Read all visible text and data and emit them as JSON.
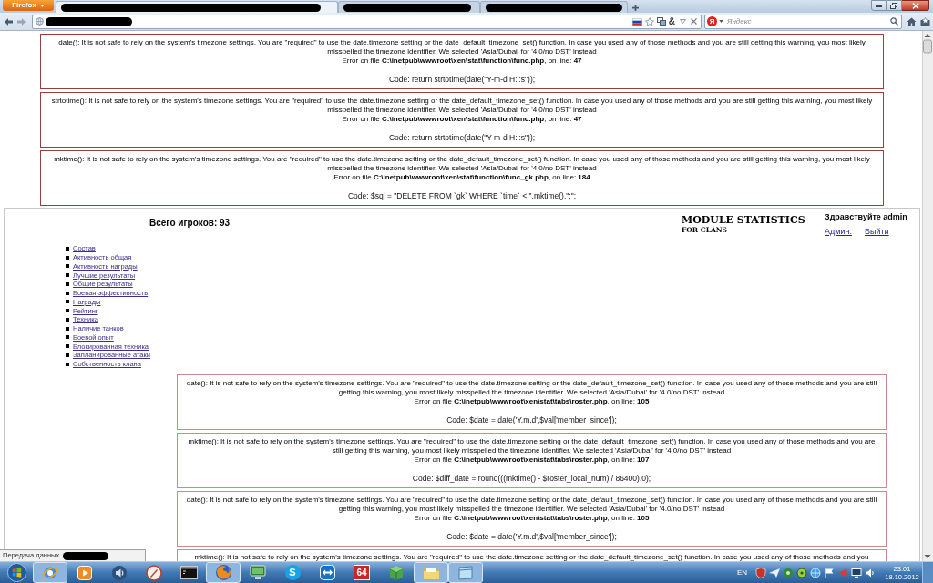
{
  "browser": {
    "menu_button": "Firefox",
    "tabs": [
      {
        "selected": true
      },
      {
        "selected": false
      },
      {
        "selected": false
      }
    ],
    "address_bar": {
      "addon_glyph": "&"
    },
    "search": {
      "engine_logo": "Я",
      "placeholder": "Яндекс"
    },
    "status_popup": "Передача данных"
  },
  "warnings_top": [
    {
      "message": "date(): It is not safe to rely on the system's timezone settings. You are \"required\" to use the date.timezone setting or the date_default_timezone_set() function. In case you used any of those methods and you are still getting this warning, you most likely misspelled the timezone identifier. We selected 'Asia/Dubai' for '4.0/no DST' instead",
      "location": "Error on file **C:\\inetpub\\wwwroot\\xen\\stat\\function\\func.php**, on line: **47**",
      "code": "Code: return strtotime(date(\"Y-m-d H:i:s\"));"
    },
    {
      "message": "strtotime(): It is not safe to rely on the system's timezone settings. You are \"required\" to use the date.timezone setting or the date_default_timezone_set() function. In case you used any of those methods and you are still getting this warning, you most likely misspelled the timezone identifier. We selected 'Asia/Dubai' for '4.0/no DST' instead",
      "location": "Error on file **C:\\inetpub\\wwwroot\\xen\\stat\\function\\func.php**, on line: **47**",
      "code": "Code: return strtotime(date(\"Y-m-d H:i:s\"));"
    },
    {
      "message": "mktime(): It is not safe to rely on the system's timezone settings. You are \"required\" to use the date.timezone setting or the date_default_timezone_set() function. In case you used any of those methods and you are still getting this warning, you most likely misspelled the timezone identifier. We selected 'Asia/Dubai' for '4.0/no DST' instead",
      "location": "Error on file **C:\\inetpub\\wwwroot\\xen\\stat\\function\\func_gk.php**, on line: **184**",
      "code": "Code: $sql = \"DELETE FROM `gk` WHERE `time` < \".mktime().\";\";"
    }
  ],
  "page": {
    "player_count": "Всего игроков: 93",
    "logo": {
      "title": "MODULE STATISTICS",
      "subtitle": "FOR CLANS"
    },
    "greeting": "Здравствуйте admin",
    "user_links": [
      "Админ.",
      "Выйти"
    ],
    "menu": [
      "Состав",
      "Активность общая",
      "Активность награды",
      "Лучшие результаты",
      "Общие результаты",
      "Боевая эффективность",
      "Награды",
      "Рейтинг",
      "Техника",
      "Наличие танков",
      "Боевой опыт",
      "Блокированная техника",
      "Запланированные атаки",
      "Собственность клана"
    ]
  },
  "warnings_bottom": [
    {
      "message": "date(): It is not safe to rely on the system's timezone settings. You are \"required\" to use the date.timezone setting or the date_default_timezone_set() function. In case you used any of those methods and you are still getting this warning, you most likely misspelled the timezone identifier. We selected 'Asia/Dubai' for '4.0/no DST' instead",
      "location": "Error on file **C:\\inetpub\\wwwroot\\xen\\stat\\tabs\\roster.php**, on line: **105**",
      "code": "Code: $date = date('Y.m.d',$val['member_since']);"
    },
    {
      "message": "mktime(): It is not safe to rely on the system's timezone settings. You are \"required\" to use the date.timezone setting or the date_default_timezone_set() function. In case you used any of those methods and you are still getting this warning, you most likely misspelled the timezone identifier. We selected 'Asia/Dubai' for '4.0/no DST' instead",
      "location": "Error on file **C:\\inetpub\\wwwroot\\xen\\stat\\tabs\\roster.php**, on line: **107**",
      "code": "Code: $diff_date = round(((mktime() - $roster_local_num) / 86400),0);"
    },
    {
      "message": "date(): It is not safe to rely on the system's timezone settings. You are \"required\" to use the date.timezone setting or the date_default_timezone_set() function. In case you used any of those methods and you are still getting this warning, you most likely misspelled the timezone identifier. We selected 'Asia/Dubai' for '4.0/no DST' instead",
      "location": "Error on file **C:\\inetpub\\wwwroot\\xen\\stat\\tabs\\roster.php**, on line: **105**",
      "code": "Code: $date = date('Y.m.d',$val['member_since']);"
    },
    {
      "message": "mktime(): It is not safe to rely on the system's timezone settings. You are \"required\" to use the date.timezone setting or the date_default_timezone_set() function. In case you used any of those methods and you"
    }
  ],
  "taskbar": {
    "apps": [
      {
        "kind": "globe-ring",
        "running": true
      },
      {
        "kind": "play-tile",
        "running": false
      },
      {
        "kind": "speaker-disc",
        "running": false
      },
      {
        "kind": "slashed-ring",
        "running": false
      },
      {
        "kind": "terminal",
        "running": false
      },
      {
        "kind": "swirl-globe",
        "running": true
      },
      {
        "kind": "monitor",
        "running": false
      },
      {
        "kind": "letter-disc",
        "label": "S",
        "running": false
      },
      {
        "kind": "arrow-tile",
        "running": false
      },
      {
        "kind": "number-tile",
        "label": "64",
        "running": false
      },
      {
        "kind": "cube",
        "running": false
      },
      {
        "kind": "folder",
        "running": true
      },
      {
        "kind": "window",
        "running": true
      }
    ],
    "language": "EN",
    "time": "23:01",
    "date": "18.10.2012"
  }
}
